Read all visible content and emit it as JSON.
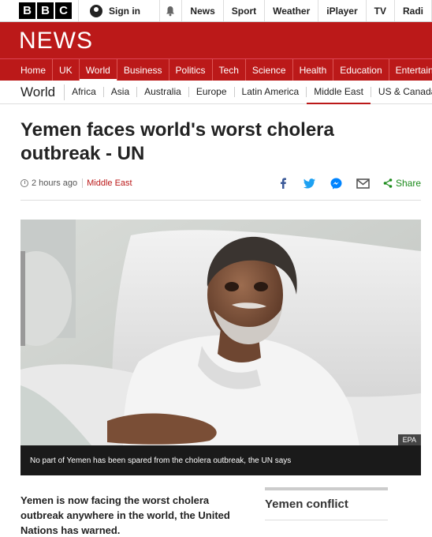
{
  "brand": {
    "letters": [
      "B",
      "B",
      "C"
    ],
    "news_wordmark": "NEWS"
  },
  "topbar": {
    "signin_label": "Sign in",
    "nav": [
      "News",
      "Sport",
      "Weather",
      "iPlayer",
      "TV",
      "Radi"
    ]
  },
  "section_nav": {
    "items": [
      "Home",
      "UK",
      "World",
      "Business",
      "Politics",
      "Tech",
      "Science",
      "Health",
      "Education",
      "Entertainn"
    ],
    "active_index": 2
  },
  "sub_nav": {
    "title": "World",
    "items": [
      "Africa",
      "Asia",
      "Australia",
      "Europe",
      "Latin America",
      "Middle East",
      "US & Canada"
    ],
    "active_index": 5
  },
  "article": {
    "headline_line1": "Yemen faces world's worst cholera",
    "headline_line2": "outbreak - UN",
    "timestamp": "2 hours ago",
    "section_tag": "Middle East",
    "share_label": "Share",
    "image_credit": "EPA",
    "image_caption": "No part of Yemen has been spared from the cholera outbreak, the UN says",
    "intro": "Yemen is now facing the worst cholera outbreak anywhere in the world, the United Nations has warned."
  },
  "sidebar": {
    "related_title": "Yemen conflict"
  },
  "colors": {
    "bbc_red": "#bb1919",
    "share_green": "#1a8a1a",
    "facebook_blue": "#3b5998",
    "twitter_blue": "#1da1f2"
  },
  "icons": [
    "user-icon",
    "bell-icon",
    "clock-icon",
    "facebook-icon",
    "twitter-icon",
    "messenger-icon",
    "email-icon",
    "share-icon"
  ]
}
